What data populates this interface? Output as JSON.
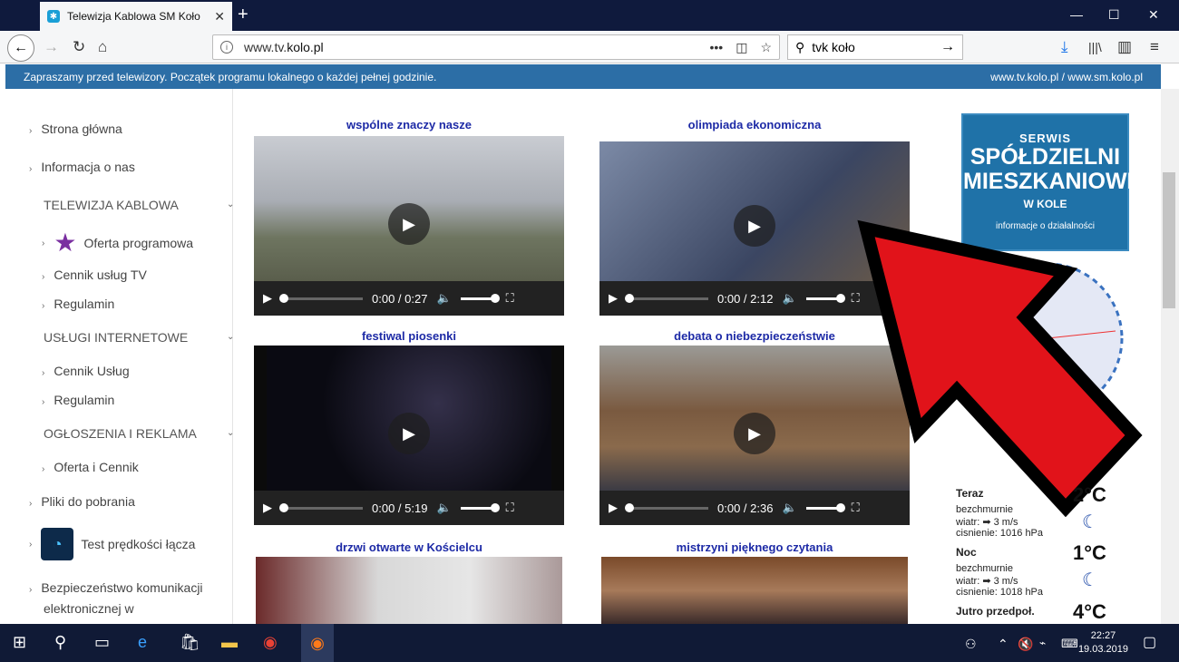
{
  "browser": {
    "tab_title": "Telewizja Kablowa SM Koło",
    "tab_close": "✕",
    "new_tab": "+",
    "minimize": "—",
    "maximize": "☐",
    "close": "✕",
    "url": "www.tv.",
    "url_host": "kolo.pl",
    "url_tools": "•••",
    "search_value": "tvk koło"
  },
  "banner": {
    "left": "Zapraszamy przed telewizory. Początek programu lokalnego o każdej pełnej godzinie.",
    "right": "www.tv.kolo.pl  /  www.sm.kolo.pl"
  },
  "sidebar": {
    "items": [
      "Strona główna",
      "Informacja o nas",
      "TELEWIZJA KABLOWA",
      "Oferta programowa",
      "Cennik usług TV",
      "Regulamin",
      "USŁUGI INTERNETOWE",
      "Cennik Usług",
      "Regulamin",
      "OGŁOSZENIA I REKLAMA",
      "Oferta i Cennik",
      "Pliki do pobrania",
      "Test prędkości łącza",
      "Bezpieczeństwo komunikacji",
      "elektronicznej w"
    ]
  },
  "videos": [
    {
      "title": "wspólne znaczy nasze",
      "time": "0:00 / 0:27"
    },
    {
      "title": "olimpiada ekonomiczna",
      "time": "0:00 / 2:12"
    },
    {
      "title": "festiwal piosenki",
      "time": "0:00 / 5:19"
    },
    {
      "title": "debata o niebezpieczeństwie",
      "time": "0:00 / 2:36"
    },
    {
      "title": "drzwi otwarte w Kościelcu"
    },
    {
      "title": "mistrzyni pięknego czytania"
    }
  ],
  "logo": {
    "line1": "SERWIS",
    "line2": "SPÓŁDZIELNI",
    "line3": "MIESZKANIOWEJ",
    "line4": "W KOLE",
    "line5": "informacje o działalności"
  },
  "weather": {
    "now_label": "Teraz",
    "now_temp": "2°C",
    "now_desc": "bezchmurnie",
    "now_wind": "wiatr: ➡ 3 m/s",
    "now_pressure": "cisnienie: 1016 hPa",
    "night_label": "Noc",
    "night_temp": "1°C",
    "night_desc": "bezchmurnie",
    "night_wind": "wiatr: ➡ 3 m/s",
    "night_pressure": "cisnienie: 1018 hPa",
    "tomorrow_label": "Jutro przedpoł.",
    "tomorrow_temp": "4°C"
  },
  "taskbar": {
    "time": "22:27",
    "date": "19.03.2019"
  }
}
